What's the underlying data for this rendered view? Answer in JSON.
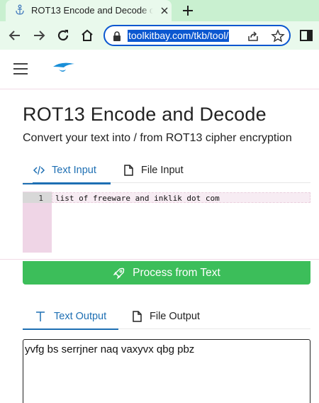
{
  "browser": {
    "tab_title": "ROT13 Encode and Decode o",
    "url": "toolkitbay.com/tkb/tool/"
  },
  "page": {
    "title": "ROT13 Encode and Decode",
    "subtitle": "Convert your text into / from ROT13 cipher encryption"
  },
  "input_tabs": [
    {
      "label": "Text Input",
      "icon": "code-icon",
      "active": true
    },
    {
      "label": "File Input",
      "icon": "file-icon",
      "active": false
    }
  ],
  "editor": {
    "line_number": "1",
    "text": "list of freeware and inklik dot com"
  },
  "process_button": {
    "label": "Process from Text",
    "icon": "rocket-icon"
  },
  "output_tabs": [
    {
      "label": "Text Output",
      "icon": "text-icon",
      "active": true
    },
    {
      "label": "File Output",
      "icon": "file-icon",
      "active": false
    }
  ],
  "output": {
    "text": "yvfg bs serrjner naq vaxyvx qbg pbz"
  },
  "colors": {
    "accent": "#1e6fb3",
    "button": "#3cbe5a",
    "browser_chrome": "#c9f0d0"
  }
}
